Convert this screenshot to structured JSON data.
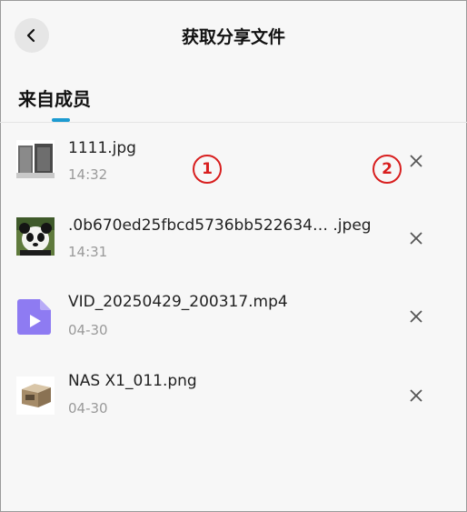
{
  "header": {
    "title": "获取分享文件",
    "back_icon": "chevron-left-icon"
  },
  "tab": {
    "label": "来自成员",
    "accent": "#1d9bd1"
  },
  "files": [
    {
      "name": "1111.jpg",
      "time": "14:32",
      "thumb": "speaker-photo"
    },
    {
      "name": ".0b670ed25fbcd5736bb522634… .jpeg",
      "time": "14:31",
      "thumb": "panda-photo"
    },
    {
      "name": "VID_20250429_200317.mp4",
      "time": "04-30",
      "thumb": "video-file-icon"
    },
    {
      "name": "NAS X1_011.png",
      "time": "04-30",
      "thumb": "nas-device-photo"
    }
  ],
  "markers": [
    "1",
    "2"
  ],
  "colors": {
    "marker": "#d81e1e",
    "video_icon": "#8e7bf2"
  }
}
